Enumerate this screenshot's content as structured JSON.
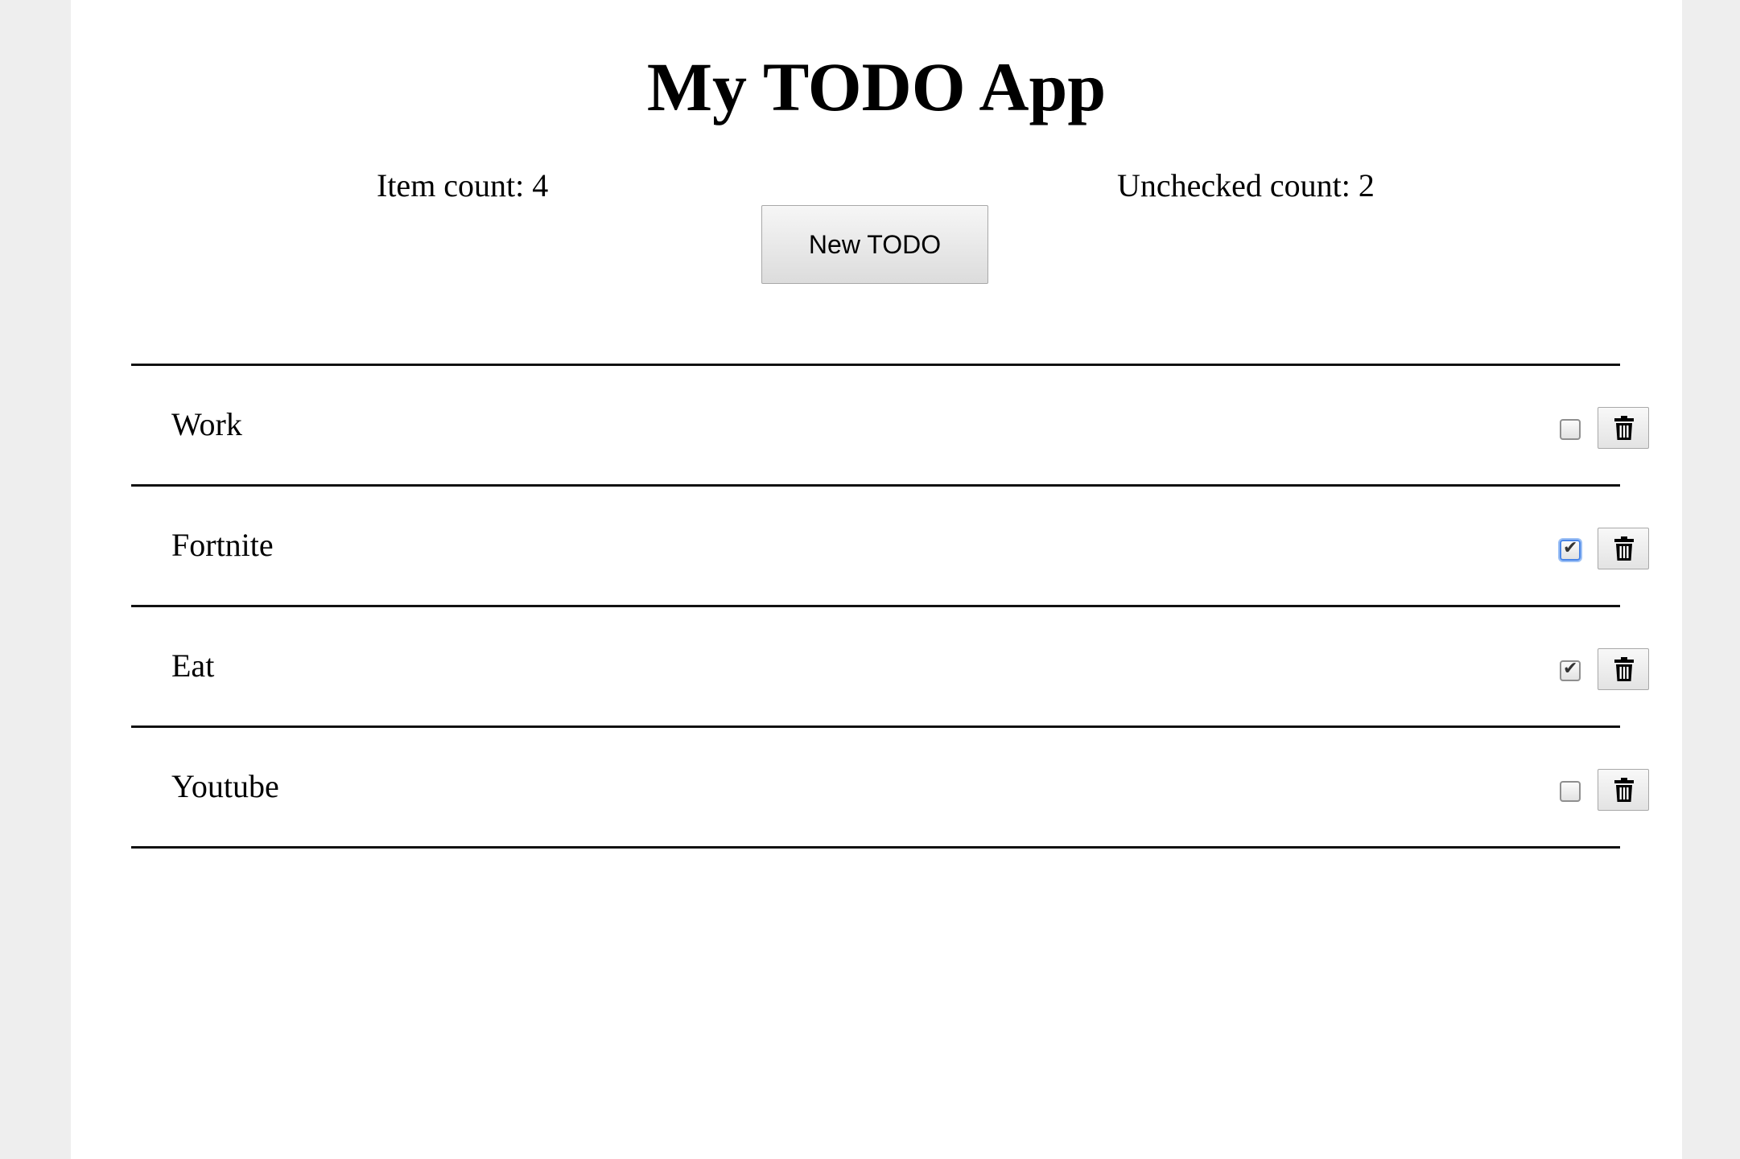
{
  "app": {
    "title": "My TODO App",
    "item_count_text": "Item count: 4",
    "unchecked_count_text": "Unchecked count: 2",
    "new_todo_label": "New TODO"
  },
  "todos": [
    {
      "label": "Work",
      "checked": false,
      "focused": false
    },
    {
      "label": "Fortnite",
      "checked": true,
      "focused": true
    },
    {
      "label": "Eat",
      "checked": true,
      "focused": false
    },
    {
      "label": "Youtube",
      "checked": false,
      "focused": false
    }
  ],
  "icons": {
    "delete": "trash-icon",
    "check": "checkmark-icon"
  },
  "colors": {
    "background": "#eeeeee",
    "page": "#ffffff",
    "divider": "#111111",
    "focus": "#4a86e8"
  }
}
